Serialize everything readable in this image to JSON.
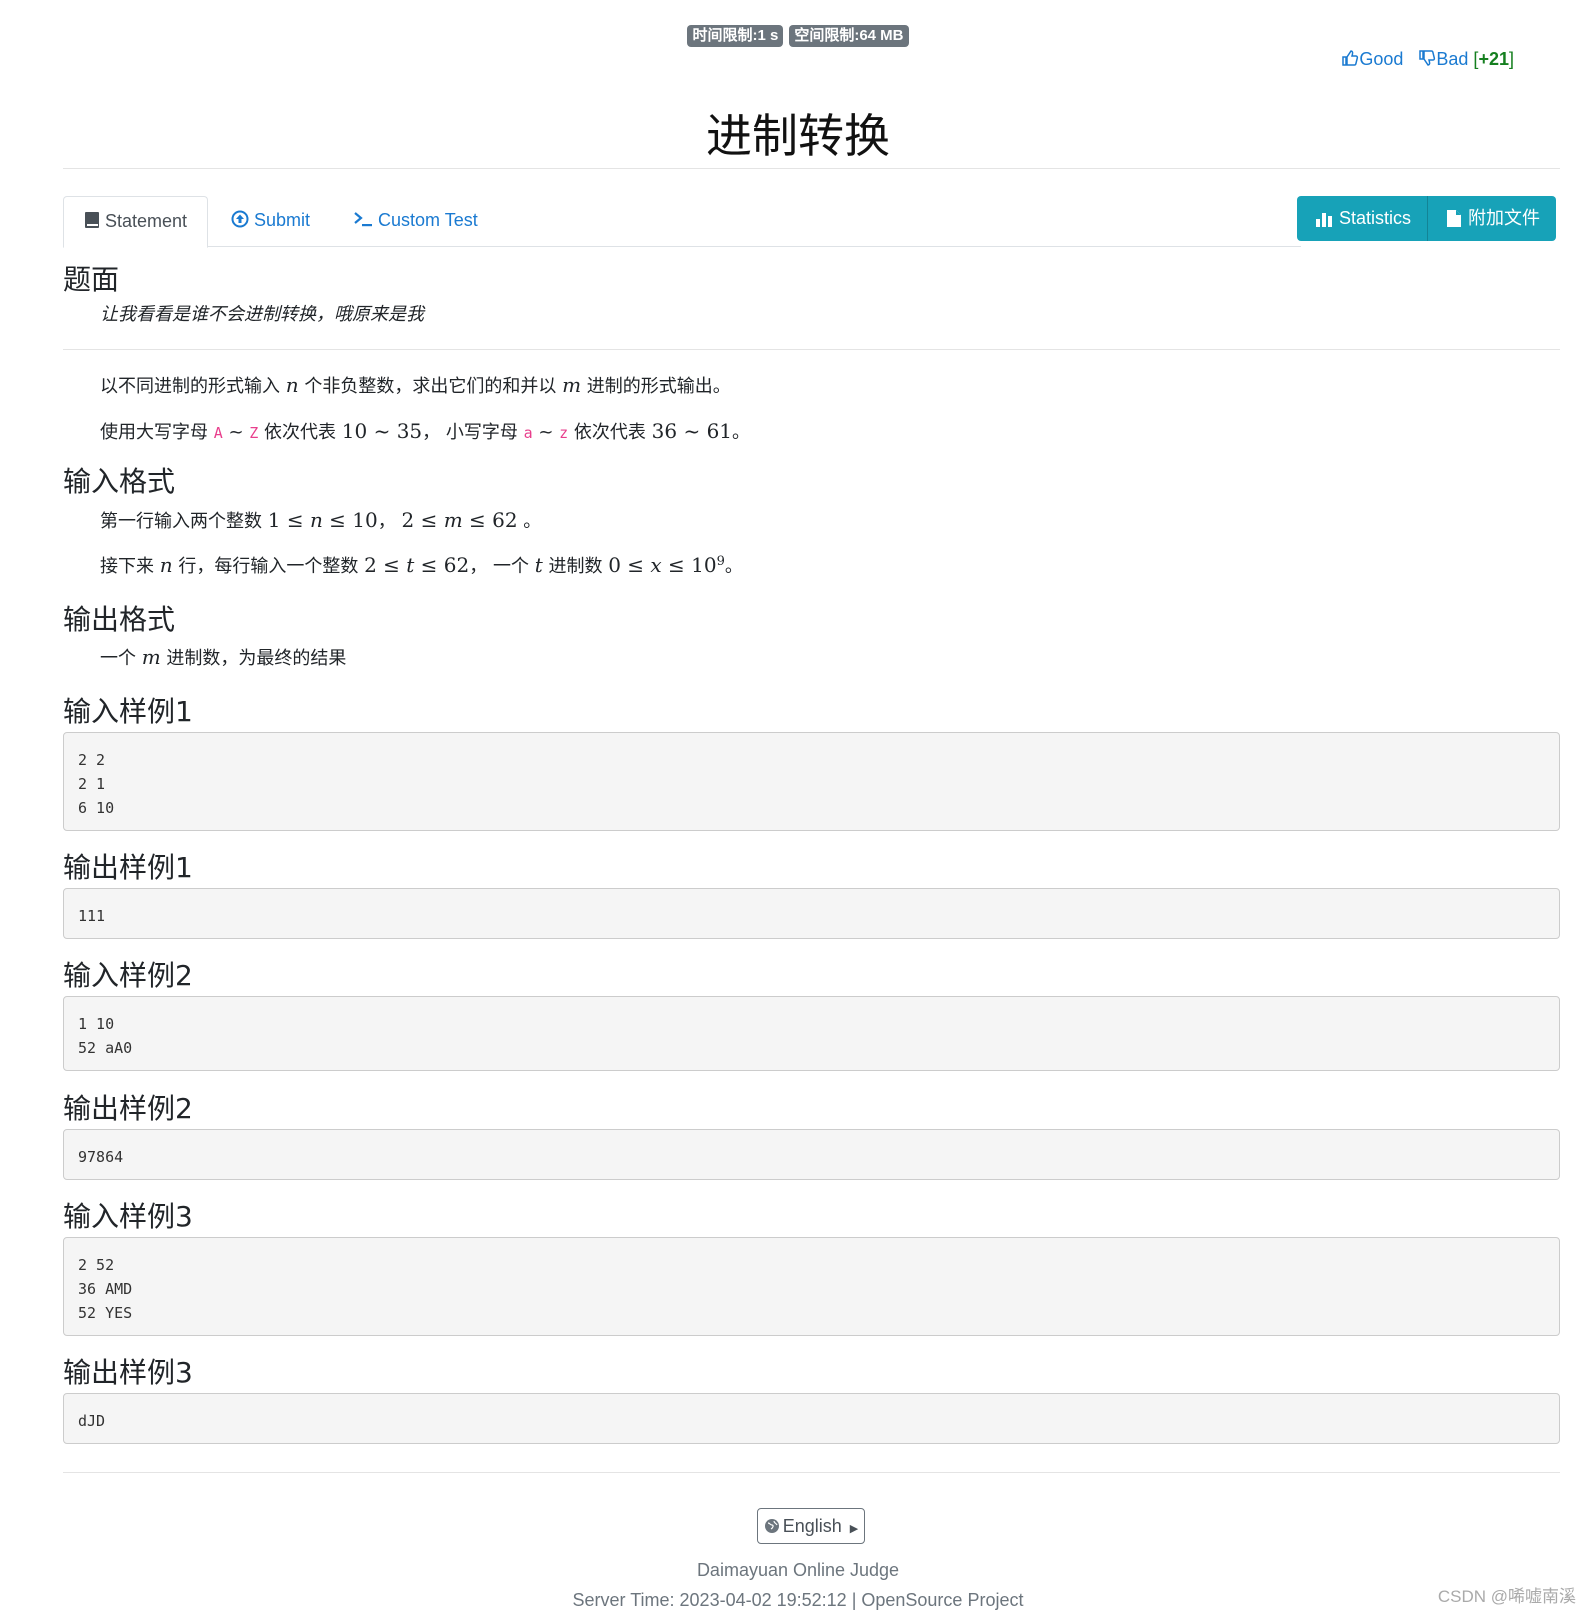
{
  "header": {
    "time_limit": "时间限制:1 s",
    "memory_limit": "空间限制:64 MB",
    "vote": {
      "good": "Good",
      "bad": "Bad",
      "score": "+21"
    },
    "title": "进制转换"
  },
  "tabs": [
    {
      "label": "Statement",
      "icon": "book-icon"
    },
    {
      "label": "Submit",
      "icon": "upload-circle-icon"
    },
    {
      "label": "Custom Test",
      "icon": "terminal-icon"
    }
  ],
  "actions": {
    "statistics": "Statistics",
    "attachments": "附加文件"
  },
  "statement": {
    "h_title": "题面",
    "quote": "让我看看是谁不会进制转换，哦原来是我",
    "desc1_a": "以不同进制的形式输入 ",
    "var_n": "n",
    "desc1_b": " 个非负整数，求出它们的和并以 ",
    "var_m": "m",
    "desc1_c": " 进制的形式输出。",
    "desc2_a": "使用大写字母 ",
    "code_A": "A",
    "tilde": " ~ ",
    "code_Z": "Z",
    "desc2_b": " 依次代表 ",
    "r1": "10 ~ 35",
    "desc2_c": "， 小写字母 ",
    "code_a": "a",
    "code_z": "z",
    "desc2_d": " 依次代表 ",
    "r2": "36 ~ 61",
    "desc2_e": "。",
    "h_input": "输入格式",
    "in1_a": "第一行输入两个整数 ",
    "in1_m1": "1 ≤ ",
    "in1_m2": " ≤ 10",
    "in1_b": "， ",
    "in1_m3": "2 ≤ ",
    "in1_m4": " ≤ 62",
    "in1_c": " 。",
    "in2_a": "接下来 ",
    "in2_b": " 行，每行输入一个整数 ",
    "in2_m1": "2 ≤ ",
    "var_t": "t",
    "in2_m2": " ≤ 62",
    "in2_c": "， 一个 ",
    "in2_d": " 进制数 ",
    "in2_m3": "0 ≤ ",
    "var_x": "x",
    "in2_m4": " ≤ 10",
    "sup9": "9",
    "in2_e": "。",
    "h_output": "输出格式",
    "out_a": "一个 ",
    "out_b": " 进制数，为最终的结果"
  },
  "samples": [
    {
      "in_title": "输入样例1",
      "in": "2 2\n2 1\n6 10",
      "out_title": "输出样例1",
      "out": "111"
    },
    {
      "in_title": "输入样例2",
      "in": "1 10\n52 aA0",
      "out_title": "输出样例2",
      "out": "97864"
    },
    {
      "in_title": "输入样例3",
      "in": "2 52\n36 AMD\n52 YES",
      "out_title": "输出样例3",
      "out": "dJD"
    }
  ],
  "footer": {
    "language": "English",
    "site": "Daimayuan Online Judge",
    "server_time": "Server Time: 2023-04-02 19:52:12",
    "sep": " | ",
    "project": "OpenSource Project"
  },
  "watermark": "CSDN @唏嘘南溪",
  "colors": {
    "accent": "#1a7ad1",
    "info": "#17a2b8",
    "badge": "#6c757d",
    "score": "#157f1f"
  }
}
